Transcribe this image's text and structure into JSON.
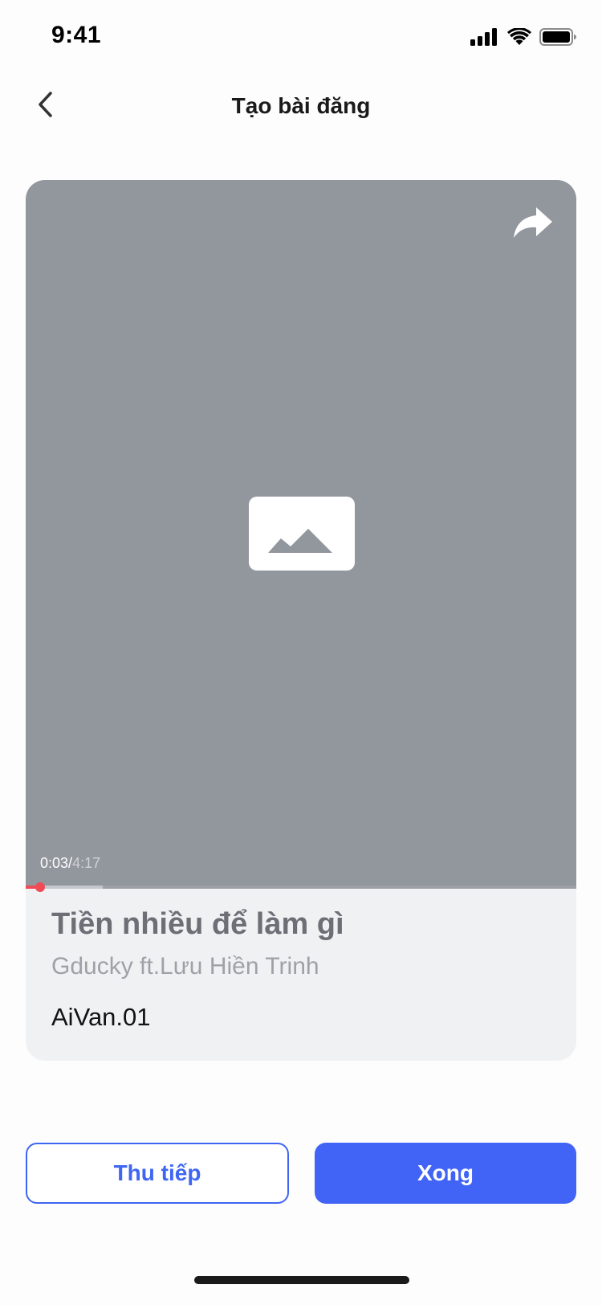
{
  "status_bar": {
    "time": "9:41",
    "icons": [
      "signal-icon",
      "wifi-icon",
      "battery-icon"
    ]
  },
  "header": {
    "title": "Tạo bài đăng",
    "back_icon": "chevron-left-icon"
  },
  "player": {
    "current_time": "0:03",
    "separator": "/",
    "total_time": "4:17",
    "progress_played": 0.012,
    "progress_buffered": 0.14,
    "share_icon": "share-icon",
    "placeholder_icon": "image-placeholder-icon",
    "colors": {
      "played": "#ef4b55",
      "media_bg": "#92969d"
    }
  },
  "song": {
    "title": "Tiền nhiều để làm gì",
    "artist": "Gducky ft.Lưu Hiền Trinh",
    "user": "AiVan.01"
  },
  "actions": {
    "continue_label": "Thu tiếp",
    "done_label": "Xong",
    "accent": "#4164f6"
  }
}
